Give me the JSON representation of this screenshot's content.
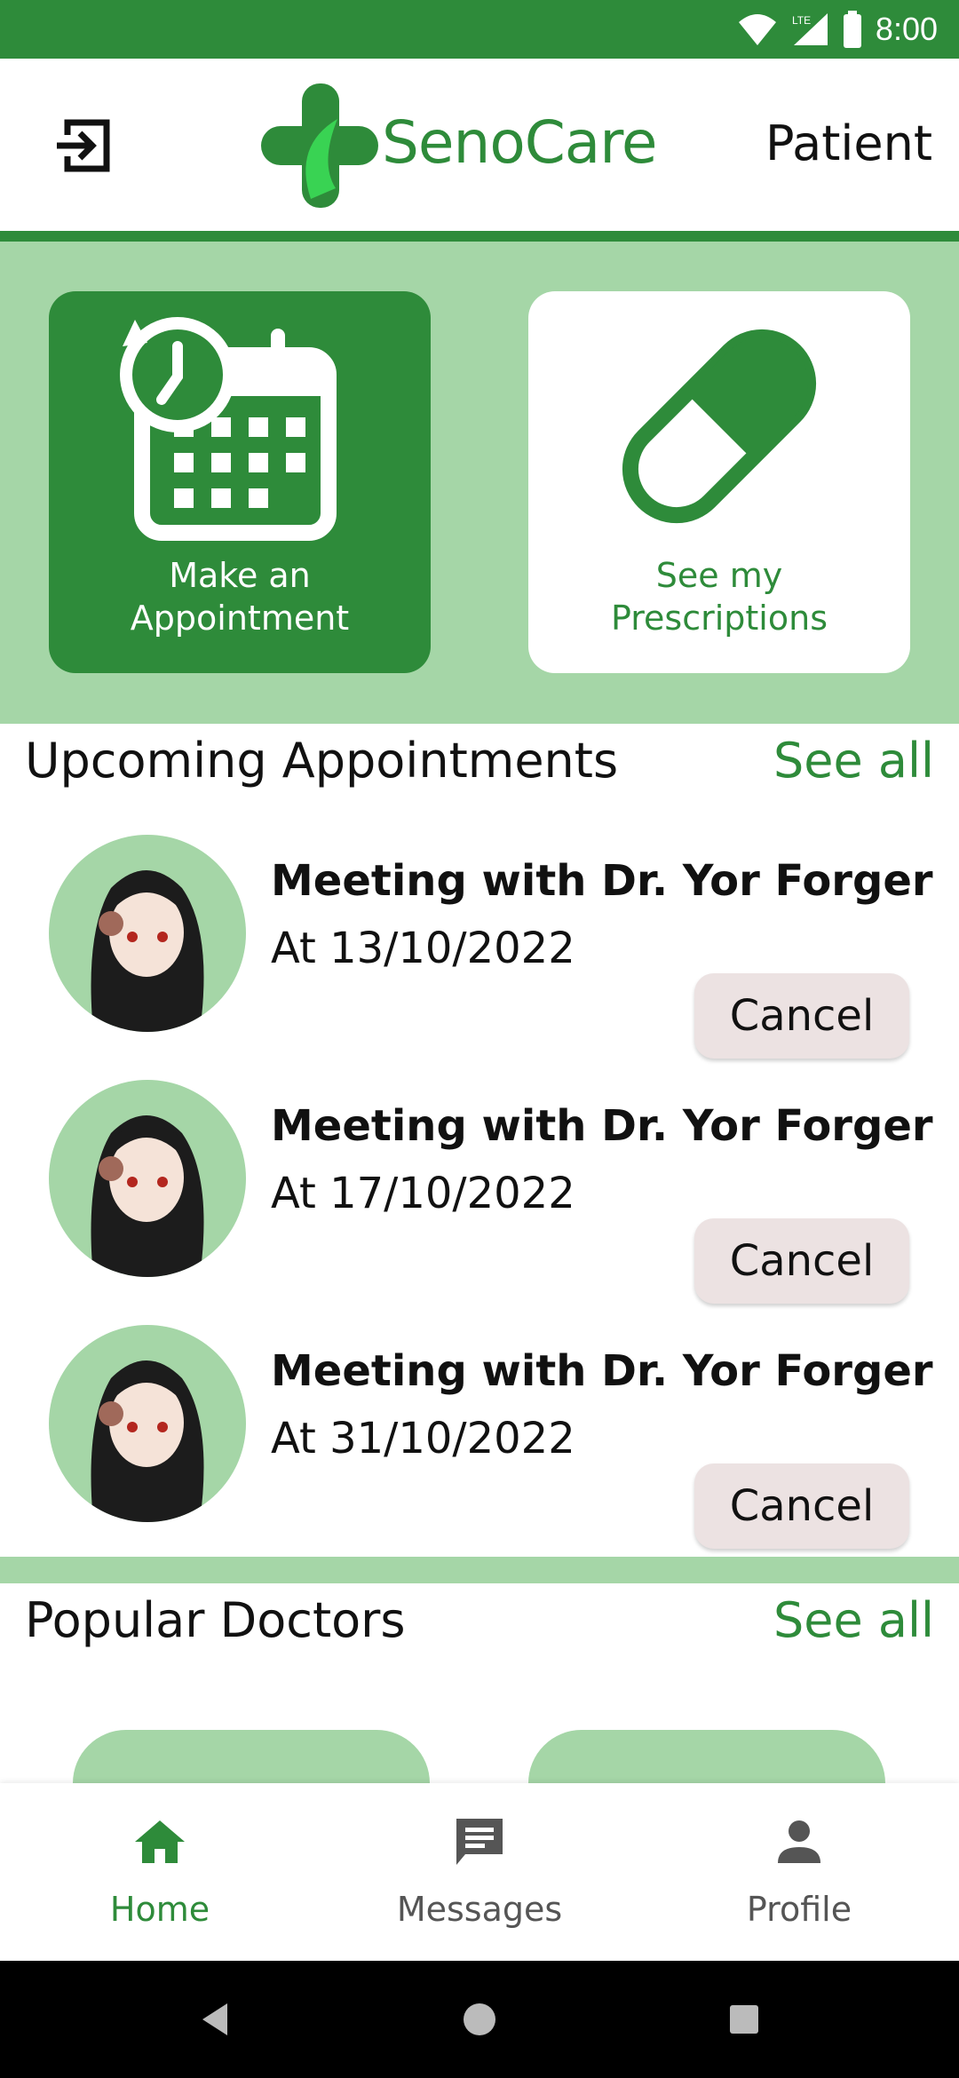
{
  "status_bar": {
    "time": "8:00",
    "network": "LTE"
  },
  "header": {
    "brand": "SenoCare",
    "role": "Patient",
    "logout_icon": "logout-icon"
  },
  "tiles": [
    {
      "label": "Make an\nAppointment",
      "icon": "calendar-clock-icon"
    },
    {
      "label": "See my\nPrescriptions",
      "icon": "pill-icon"
    }
  ],
  "upcoming": {
    "title": "Upcoming Appointments",
    "see_all": "See all",
    "items": [
      {
        "title": "Meeting with Dr. Yor Forger",
        "date": "At 13/10/2022",
        "cancel": "Cancel"
      },
      {
        "title": "Meeting with Dr. Yor Forger",
        "date": "At 17/10/2022",
        "cancel": "Cancel"
      },
      {
        "title": "Meeting with Dr. Yor Forger",
        "date": "At 31/10/2022",
        "cancel": "Cancel"
      }
    ]
  },
  "popular": {
    "title": "Popular Doctors",
    "see_all": "See all"
  },
  "bottom_nav": [
    {
      "label": "Home",
      "icon": "home-icon",
      "active": true
    },
    {
      "label": "Messages",
      "icon": "message-icon",
      "active": false
    },
    {
      "label": "Profile",
      "icon": "person-icon",
      "active": false
    }
  ],
  "colors": {
    "primary": "#2e8b3a",
    "light": "#a5d6a7",
    "cancel_bg": "#ece2e2"
  }
}
